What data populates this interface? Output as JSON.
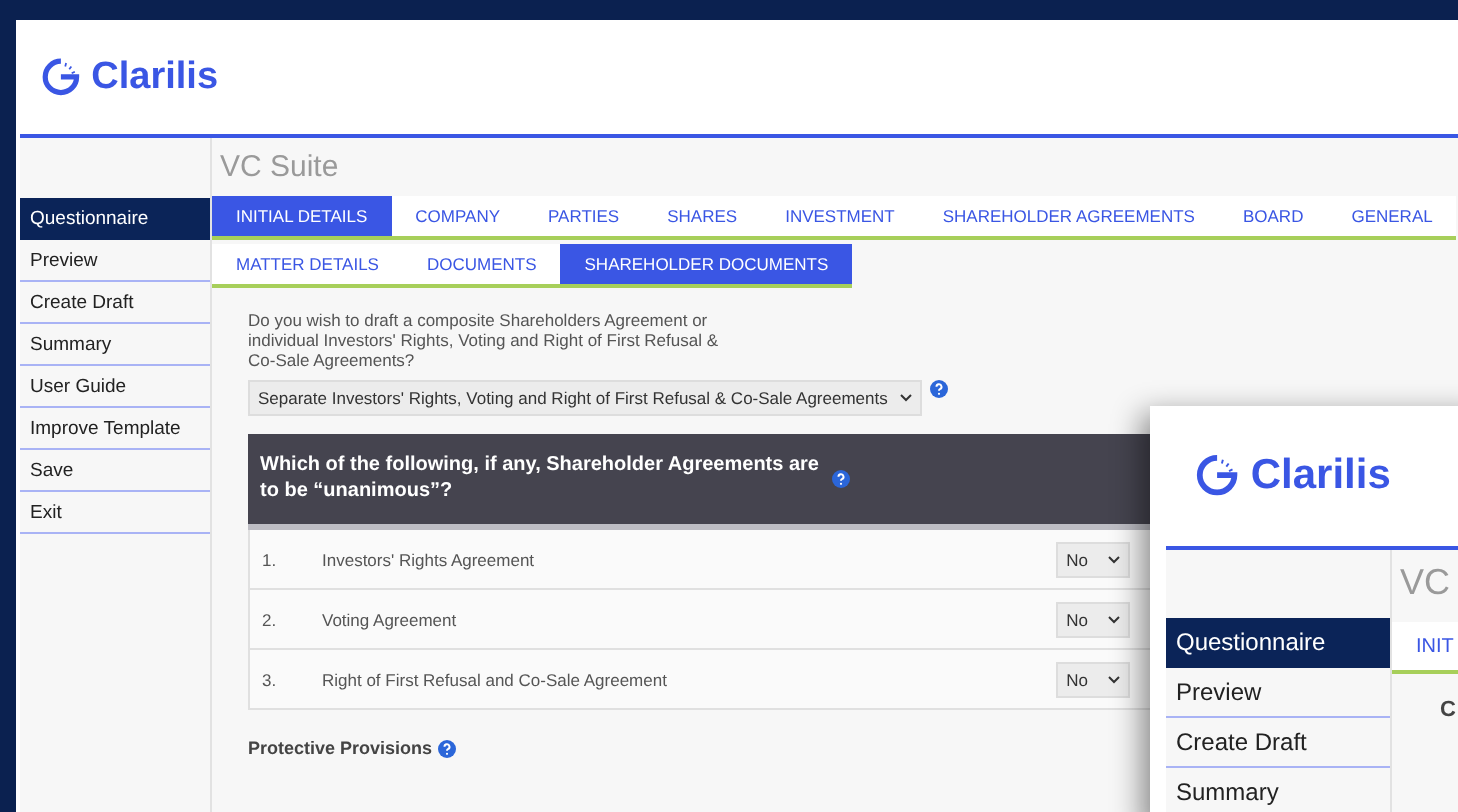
{
  "main_window": {
    "logo": "Clarilis",
    "suite_title": "VC Suite",
    "sidebar": [
      {
        "label": "Questionnaire",
        "selected": true
      },
      {
        "label": "Preview",
        "selected": false
      },
      {
        "label": "Create Draft",
        "selected": false
      },
      {
        "label": "Summary",
        "selected": false
      },
      {
        "label": "User Guide",
        "selected": false
      },
      {
        "label": "Improve Template",
        "selected": false
      },
      {
        "label": "Save",
        "selected": false
      },
      {
        "label": "Exit",
        "selected": false
      }
    ],
    "tabs": [
      {
        "label": "INITIAL DETAILS",
        "selected": true
      },
      {
        "label": "COMPANY",
        "selected": false
      },
      {
        "label": "PARTIES",
        "selected": false
      },
      {
        "label": "SHARES",
        "selected": false
      },
      {
        "label": "INVESTMENT",
        "selected": false
      },
      {
        "label": "SHAREHOLDER AGREEMENTS",
        "selected": false
      },
      {
        "label": "BOARD",
        "selected": false
      },
      {
        "label": "GENERAL",
        "selected": false
      }
    ],
    "subtabs": [
      {
        "label": "MATTER DETAILS",
        "selected": false
      },
      {
        "label": "DOCUMENTS",
        "selected": false
      },
      {
        "label": "SHAREHOLDER DOCUMENTS",
        "selected": true
      }
    ],
    "question": "Do you wish to draft a composite Shareholders Agreement or individual Investors' Rights, Voting and Right of First Refusal & Co-Sale Agreements?",
    "question_answer": "Separate Investors' Rights, Voting and Right of First Refusal & Co-Sale Agreements",
    "section_heading": "Which of the following, if any, Shareholder Agreements are to be “unanimous”?",
    "rows": [
      {
        "number": "1.",
        "label": "Investors' Rights Agreement",
        "value": "No"
      },
      {
        "number": "2.",
        "label": "Voting Agreement",
        "value": "No"
      },
      {
        "number": "3.",
        "label": "Right of First Refusal and Co-Sale Agreement",
        "value": "No"
      }
    ],
    "next_heading": "Protective Provisions"
  },
  "front_window": {
    "logo": "Clarilis",
    "suite_title": "VC",
    "tab": "INIT",
    "content_text": "C",
    "sidebar": [
      {
        "label": "Questionnaire",
        "selected": true
      },
      {
        "label": "Preview",
        "selected": false
      },
      {
        "label": "Create Draft",
        "selected": false
      },
      {
        "label": "Summary",
        "selected": false
      }
    ]
  }
}
